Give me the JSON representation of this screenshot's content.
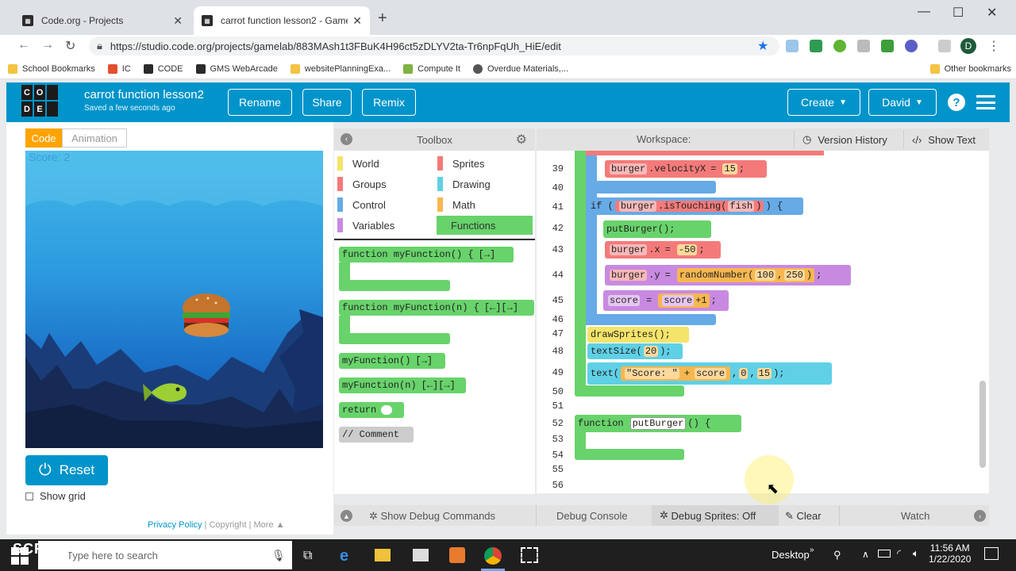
{
  "browser": {
    "tabs": [
      {
        "title": "Code.org - Projects"
      },
      {
        "title": "carrot function lesson2 - Game L..."
      }
    ],
    "url": "https://studio.code.org/projects/gamelab/883MAsh1t3FBuK4H96ct5zDLYV2ta-Tr6npFqUh_HiE/edit",
    "profile_initial": "D",
    "bookmarks": [
      "School Bookmarks",
      "IC",
      "CODE",
      "GMS WebArcade",
      "websitePlanningExa...",
      "Compute It",
      "Overdue Materials,..."
    ],
    "other_bookmarks": "Other bookmarks"
  },
  "header": {
    "logo_letters": [
      "C",
      "O",
      "",
      "D",
      "E",
      ""
    ],
    "project_title": "carrot function lesson2",
    "saved_status": "Saved a few seconds ago",
    "rename": "Rename",
    "share": "Share",
    "remix": "Remix",
    "create": "Create",
    "user": "David"
  },
  "left": {
    "code_tab": "Code",
    "animation_tab": "Animation",
    "score_text": "Score: 2",
    "reset": "Reset",
    "show_grid": "Show grid",
    "privacy": "Privacy Policy",
    "copyright": "Copyright",
    "more": "More"
  },
  "toolbox": {
    "title": "Toolbox",
    "categories": [
      {
        "label": "World",
        "color": "#f4e46a"
      },
      {
        "label": "Sprites",
        "color": "#f47a7a"
      },
      {
        "label": "Groups",
        "color": "#f47a7a"
      },
      {
        "label": "Drawing",
        "color": "#5fd0e6"
      },
      {
        "label": "Control",
        "color": "#66aae6"
      },
      {
        "label": "Math",
        "color": "#f7b750"
      },
      {
        "label": "Variables",
        "color": "#c88ae0"
      },
      {
        "label": "Functions",
        "color": "#68d36b"
      }
    ],
    "blocks": {
      "func_def": "function myFunction() {",
      "func_def_param": "function myFunction(n) {",
      "call": "myFunction()",
      "call_param": "myFunction(n)",
      "return": "return",
      "comment": "// Comment"
    }
  },
  "workspace": {
    "title": "Workspace:",
    "version_history": "Version History",
    "show_text": "Show Text",
    "line_numbers": [
      "39",
      "40",
      "41",
      "42",
      "43",
      "44",
      "45",
      "46",
      "47",
      "48",
      "49",
      "50",
      "51",
      "52",
      "53",
      "54",
      "55",
      "56"
    ],
    "code": {
      "l39_obj": "burger",
      "l39_prop": ".velocityX",
      "l39_val": "15",
      "l41_if": "if (",
      "l41_obj": "burger",
      "l41_method": ".isTouching(",
      "l41_arg": "fish",
      "l42": "putBurger();",
      "l43_obj": "burger",
      "l43_prop": ".x",
      "l43_val": "-50",
      "l44_obj": "burger",
      "l44_prop": ".y",
      "l44_fn": "randomNumber(",
      "l44_a": "100",
      "l44_b": "250",
      "l45_var": "score",
      "l45_expr_var": "score",
      "l45_expr_op": "+1",
      "l47": "drawSprites();",
      "l48_fn": "textSize(",
      "l48_arg": "20",
      "l49_fn": "text(",
      "l49_str": "\"Score: \"",
      "l49_op": "+",
      "l49_var": "score",
      "l49_x": "0",
      "l49_y": "15",
      "l52_kw": "function",
      "l52_name": "putBurger",
      "l52_tail": "() {"
    }
  },
  "bottom": {
    "debug_commands": "Show Debug Commands",
    "debug_console": "Debug Console",
    "debug_sprites": "Debug Sprites: Off",
    "clear": "Clear",
    "watch": "Watch"
  },
  "taskbar": {
    "search_placeholder": "Type here to search",
    "desktop": "Desktop",
    "time": "11:56 AM",
    "date": "1/22/2020",
    "watermark_top": "RECORDED WITH",
    "watermark": "SCREENCAST MATIC"
  }
}
